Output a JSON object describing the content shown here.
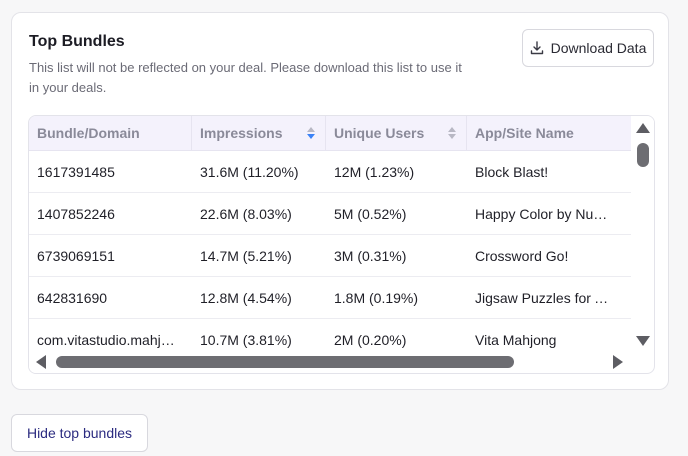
{
  "card": {
    "title": "Top Bundles",
    "subtitle": "This list will not be reflected on your deal. Please download this list to use it in your deals.",
    "download_label": "Download Data"
  },
  "table": {
    "columns": [
      "Bundle/Domain",
      "Impressions",
      "Unique Users",
      "App/Site Name"
    ],
    "sorted_column": "Impressions",
    "sort_direction": "descending",
    "rows": [
      [
        "1617391485",
        "31.6M (11.20%)",
        "12M (1.23%)",
        "Block Blast!"
      ],
      [
        "1407852246",
        "22.6M (8.03%)",
        "5M (0.52%)",
        "Happy Color by Numbers"
      ],
      [
        "6739069151",
        "14.7M (5.21%)",
        "3M (0.31%)",
        "Crossword Go!"
      ],
      [
        "642831690",
        "12.8M (4.54%)",
        "1.8M (0.19%)",
        "Jigsaw Puzzles for Adults"
      ],
      [
        "com.vitastudio.mahjong",
        "10.7M (3.81%)",
        "2M (0.20%)",
        "Vita Mahjong"
      ]
    ]
  },
  "footer": {
    "hide_label": "Hide top bundles"
  },
  "colors": {
    "header_bg": "#f4f2fc",
    "sort_active": "#3b82f6",
    "sort_inactive": "#b8b8c4",
    "link_text": "#2b2b80"
  },
  "icons": {
    "download": "download-icon",
    "sort": "sort-icon"
  }
}
